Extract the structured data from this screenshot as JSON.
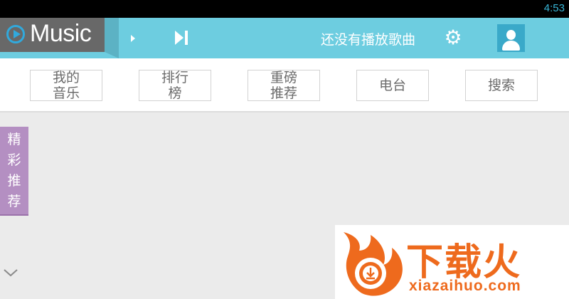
{
  "status_bar": {
    "time": "4:53"
  },
  "header": {
    "app_name": "Music",
    "now_playing": "还没有播放歌曲",
    "play_icon": "play-icon",
    "next_icon": "skip-next-icon",
    "settings_icon": "gear-icon",
    "avatar_icon": "user-avatar-icon"
  },
  "tabs": [
    {
      "label": "我的\n音乐"
    },
    {
      "label": "排行\n榜"
    },
    {
      "label": "重磅\n推荐"
    },
    {
      "label": "电台"
    },
    {
      "label": "搜索"
    }
  ],
  "side_tab": {
    "chars": [
      "精",
      "彩",
      "推",
      "荐"
    ]
  },
  "watermark": {
    "title": "下载火",
    "url": "xiazaihuo.com"
  },
  "colors": {
    "header": "#6dcde0",
    "logo_bg": "#686868",
    "side_tab": "#b48fc2",
    "watermark": "#ee6a1d"
  }
}
